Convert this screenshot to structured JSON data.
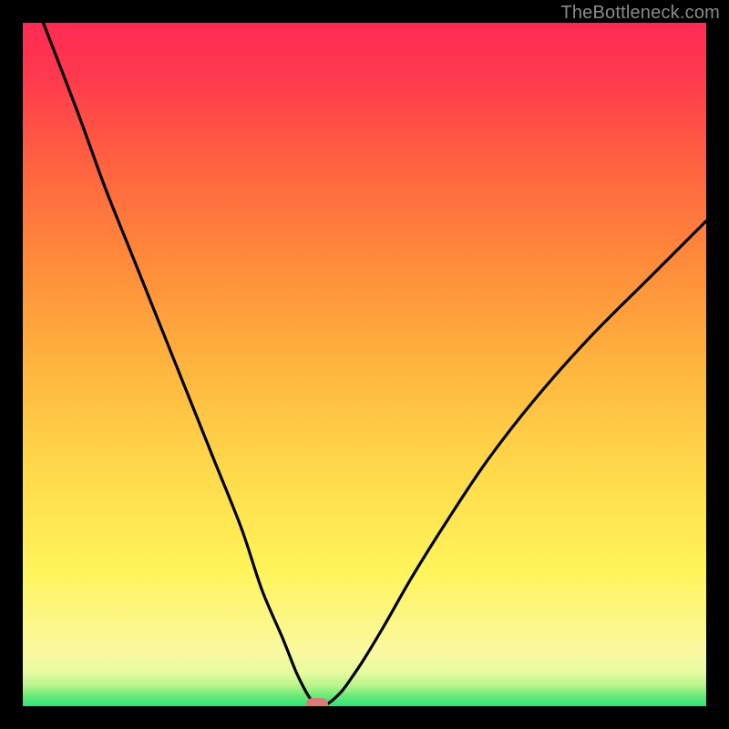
{
  "watermark": "TheBottleneck.com",
  "chart_data": {
    "type": "line",
    "title": "",
    "xlabel": "",
    "ylabel": "",
    "xlim": [
      0,
      100
    ],
    "ylim": [
      0,
      100
    ],
    "grid": false,
    "series": [
      {
        "name": "bottleneck-curve",
        "x": [
          3,
          8,
          12,
          16,
          20,
          24,
          28,
          32,
          35,
          38,
          40,
          41.5,
          42.5,
          43,
          44.5,
          46.5,
          48,
          50,
          53,
          57,
          62,
          68,
          75,
          83,
          92,
          100
        ],
        "y": [
          100,
          87,
          76,
          66,
          56,
          46,
          36,
          26,
          17,
          10,
          5,
          2,
          0.5,
          0,
          0.3,
          2,
          4,
          7,
          12,
          19,
          27,
          36,
          45,
          54,
          63,
          71
        ]
      }
    ],
    "annotations": [
      {
        "name": "optimal-marker",
        "x": 43,
        "y": 0.3
      }
    ],
    "background_gradient": {
      "stops": [
        {
          "pct": 0,
          "color": "#2fe37a"
        },
        {
          "pct": 1.5,
          "color": "#67ea77"
        },
        {
          "pct": 3,
          "color": "#b7f48a"
        },
        {
          "pct": 5,
          "color": "#e7fa9f"
        },
        {
          "pct": 8,
          "color": "#faf9a0"
        },
        {
          "pct": 20,
          "color": "#fff45a"
        },
        {
          "pct": 35,
          "color": "#ffd84a"
        },
        {
          "pct": 50,
          "color": "#ffb43e"
        },
        {
          "pct": 65,
          "color": "#ff8b3a"
        },
        {
          "pct": 80,
          "color": "#ff6040"
        },
        {
          "pct": 92,
          "color": "#ff3a4e"
        },
        {
          "pct": 100,
          "color": "#ff2a54"
        }
      ]
    }
  }
}
